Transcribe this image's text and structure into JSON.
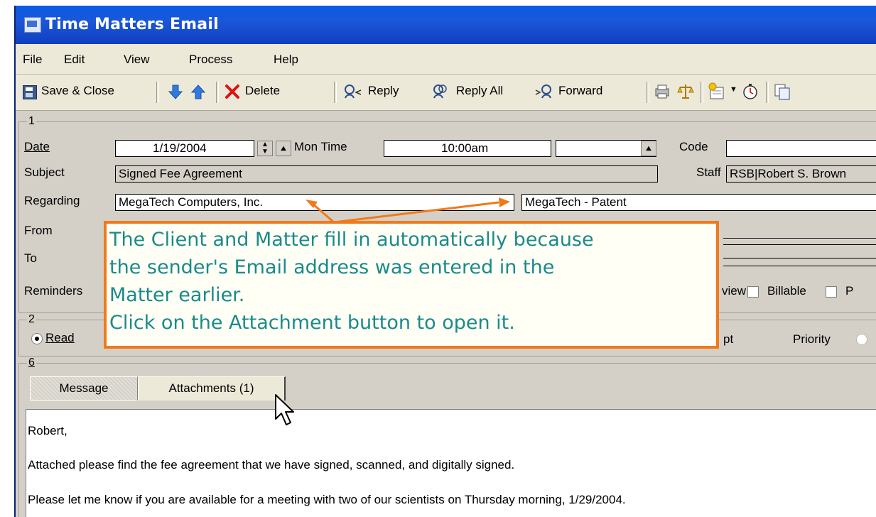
{
  "window": {
    "title": "Time Matters Email"
  },
  "menu": [
    "File",
    "Edit",
    "View",
    "Process",
    "Help"
  ],
  "toolbar": {
    "save_close": "Save & Close",
    "delete": "Delete",
    "reply": "Reply",
    "reply_all": "Reply All",
    "forward": "Forward"
  },
  "section1": {
    "number": "1",
    "date_label": "Date",
    "date_value": "1/19/2004",
    "day_time_label": "Mon  Time",
    "time_value": "10:00am",
    "end_time_value": "",
    "code_label": "Code",
    "code_value": "",
    "subject_label": "Subject",
    "subject_value": "Signed Fee Agreement",
    "staff_label": "Staff",
    "staff_value": "RSB|Robert S. Brown",
    "regarding_label": "Regarding",
    "client_value": "MegaTech Computers, Inc.",
    "matter_value": "MegaTech - Patent",
    "from_label": "From",
    "to_label": "To",
    "reminders_label": "Reminders",
    "view_label": "view",
    "billable_label": "Billable",
    "p_label": "P"
  },
  "section2": {
    "number": "2",
    "read_label": "Read",
    "pt_label": "pt",
    "priority_label": "Priority"
  },
  "section6": {
    "number": "6",
    "tabs": [
      "Message",
      "Attachments (1)"
    ]
  },
  "message": {
    "lines": [
      "Robert,",
      "Attached please find the fee agreement that we have signed, scanned, and digitally signed.",
      "Please let me know if you are available for a meeting with two of our scientists on Thursday morning, 1/29/2004."
    ]
  },
  "callout": {
    "lines": [
      "The Client and Matter fill in automatically because",
      "the sender's Email address was entered in the",
      "Matter earlier.",
      "Click on the Attachment button to open it."
    ],
    "border_color": "#f07a1a",
    "text_color": "#1a8a8a"
  }
}
